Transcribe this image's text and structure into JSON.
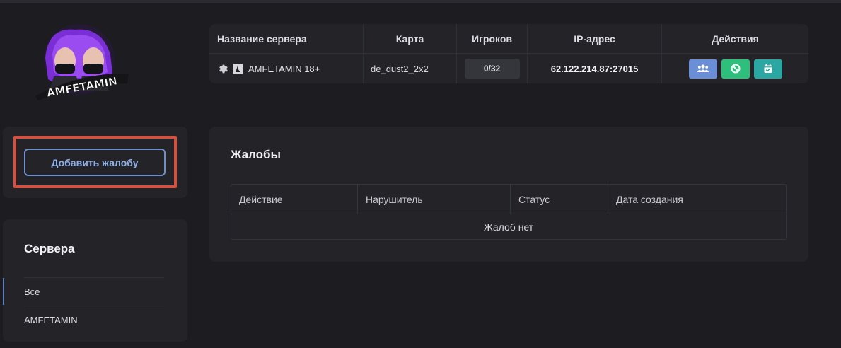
{
  "logo": {
    "text": "AMFETAMIN"
  },
  "sidebar": {
    "add_complaint_label": "Добавить жалобу",
    "servers_title": "Сервера",
    "items": [
      {
        "label": "Все",
        "active": true
      },
      {
        "label": "AMFETAMIN",
        "active": false
      }
    ]
  },
  "server_table": {
    "headers": {
      "name": "Название сервера",
      "map": "Карта",
      "players": "Игроков",
      "ip": "IP-адрес",
      "actions": "Действия"
    },
    "row": {
      "name": "AMFETAMIN 18+",
      "map": "de_dust2_2x2",
      "players": "0/32",
      "ip": "62.122.214.87:27015"
    },
    "action_icons": [
      "users-icon",
      "ban-icon",
      "calendar-check-icon"
    ],
    "action_colors": [
      "#6a8fd6",
      "#2fbf7d",
      "#2aa7a2"
    ]
  },
  "complaints": {
    "title": "Жалобы",
    "headers": {
      "action": "Действие",
      "offender": "Нарушитель",
      "status": "Статус",
      "created": "Дата создания"
    },
    "empty_text": "Жалоб нет"
  },
  "colors": {
    "background": "#1c1c21",
    "card": "#232328",
    "accent": "#6f8fc9",
    "highlight_frame": "#d4503f"
  }
}
